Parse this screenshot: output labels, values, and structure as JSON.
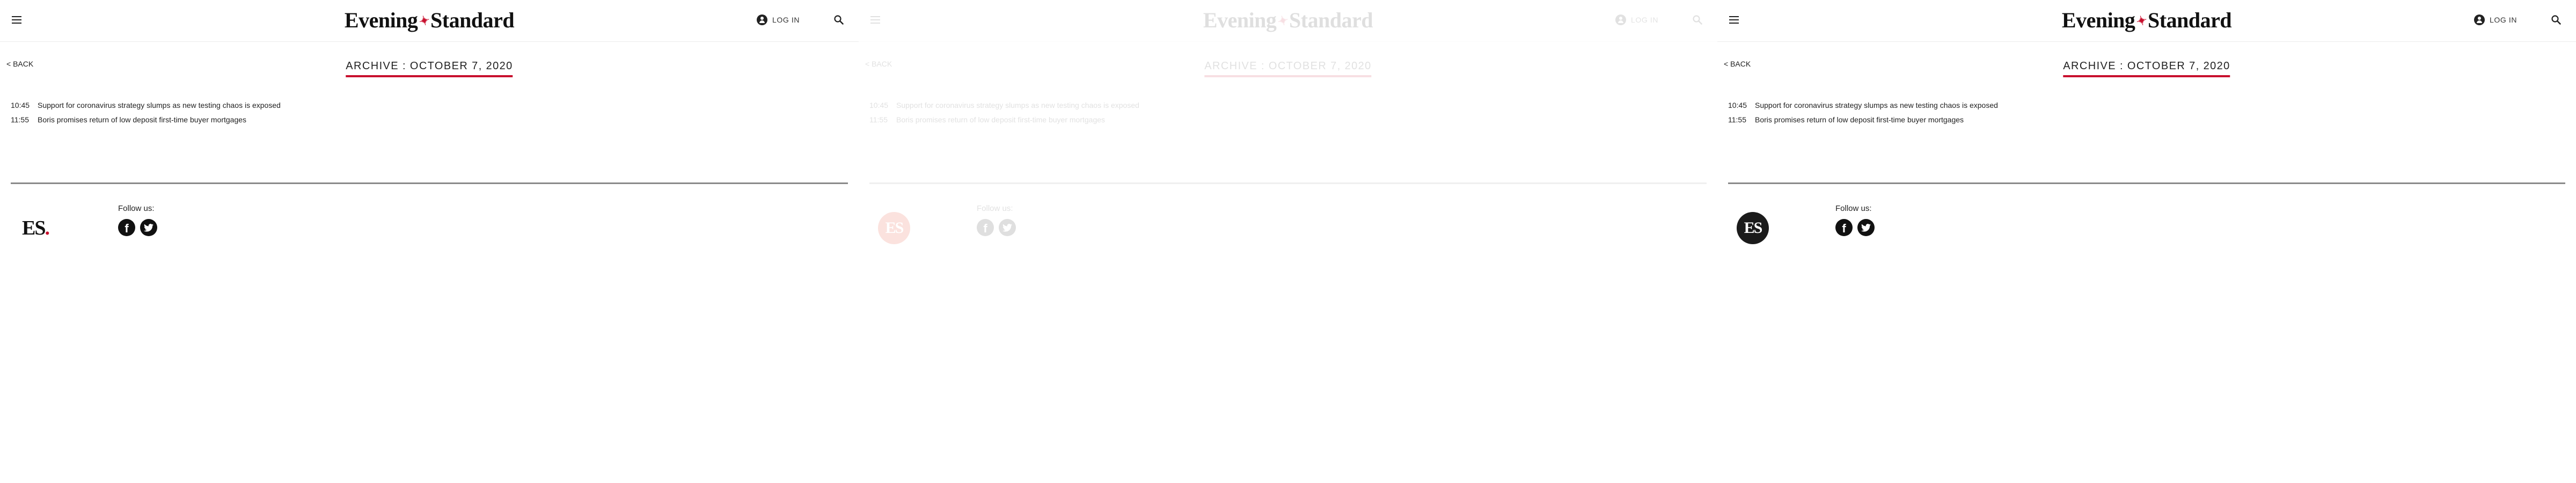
{
  "site": {
    "logo_left": "Evening",
    "logo_mark": "✦",
    "logo_right": "Standard",
    "login_label": "LOG IN",
    "back_label": "< BACK",
    "archive_title": "ARCHIVE : OCTOBER 7, 2020",
    "follow_label": "Follow us:",
    "footer_logo_text": "ES",
    "footer_logo_dot": ".",
    "accent_color": "#c8102e"
  },
  "articles": [
    {
      "time": "10:45",
      "title": "Support for coronavirus strategy slumps as new testing chaos is exposed"
    },
    {
      "time": "11:55",
      "title": "Boris promises return of low deposit first-time buyer mortgages"
    }
  ],
  "panels": [
    {
      "state": "normal",
      "footer_logo_style": "plain"
    },
    {
      "state": "faded",
      "footer_logo_style": "circle-red"
    },
    {
      "state": "normal",
      "footer_logo_style": "circle-black"
    }
  ],
  "icons": {
    "menu": "hamburger-icon",
    "account": "user-icon",
    "search": "search-icon",
    "facebook": "facebook-icon",
    "twitter": "twitter-icon"
  }
}
